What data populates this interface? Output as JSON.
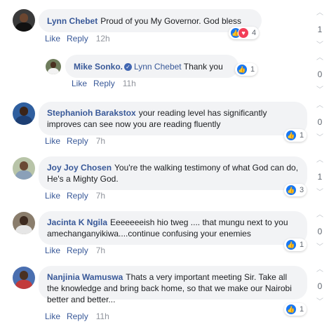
{
  "comments": [
    {
      "author": "Lynn Chebet",
      "text": "Proud of you My Governor. God bless",
      "like": "Like",
      "reply": "Reply",
      "time": "12h",
      "reactions": "4",
      "score": "1",
      "avatar_bg": "#3a3a3a",
      "avatar_skin": "#6b4630"
    },
    {
      "author": "Mike Sonko.",
      "mention": "Lynn Chebet",
      "text": "Thank you",
      "like": "Like",
      "reply": "Reply",
      "time": "11h",
      "reactions": "1",
      "score": "0",
      "avatar_bg": "#6e7c5c",
      "avatar_skin": "#4a3122"
    },
    {
      "author": "Stephanioh Barakstox",
      "text": "your reading level has significantly improves can see now you are reading fluently",
      "like": "Like",
      "reply": "Reply",
      "time": "7h",
      "reactions": "1",
      "score": "0",
      "avatar_bg": "#2f5f9f",
      "avatar_skin": "#3b2418"
    },
    {
      "author": "Joy Joy Chosen",
      "text": "You're the walking testimony of what God can do, He's a Mighty God.",
      "like": "Like",
      "reply": "Reply",
      "time": "7h",
      "reactions": "3",
      "score": "1",
      "avatar_bg": "#b8c4a8",
      "avatar_skin": "#6b4a35"
    },
    {
      "author": "Jacinta K Ngila",
      "text": "Eeeeeeeish hio tweg .... that mungu next to you amechanganyikiwa....continue confusing your enemies",
      "like": "Like",
      "reply": "Reply",
      "time": "7h",
      "reactions": "1",
      "score": "0",
      "avatar_bg": "#8a7d6c",
      "avatar_skin": "#3d2a1f"
    },
    {
      "author": "Nanjinia Wamuswa",
      "text": "Thats a very important meeting Sir. Take all the knowledge and bring back home, so that we make our Nairobi better and better...",
      "like": "Like",
      "reply": "Reply",
      "time": "11h",
      "reactions": "1",
      "score": "0",
      "avatar_bg": "#4a6fb0",
      "avatar_skin": "#4a3122"
    }
  ],
  "colors": {
    "link": "#385898",
    "bubble": "#f2f3f5",
    "like": "#1877f2",
    "love": "#f33e58"
  },
  "icons": {
    "up": "upvote-arrow-icon",
    "down": "downvote-arrow-icon",
    "verified": "verified-badge-icon"
  }
}
